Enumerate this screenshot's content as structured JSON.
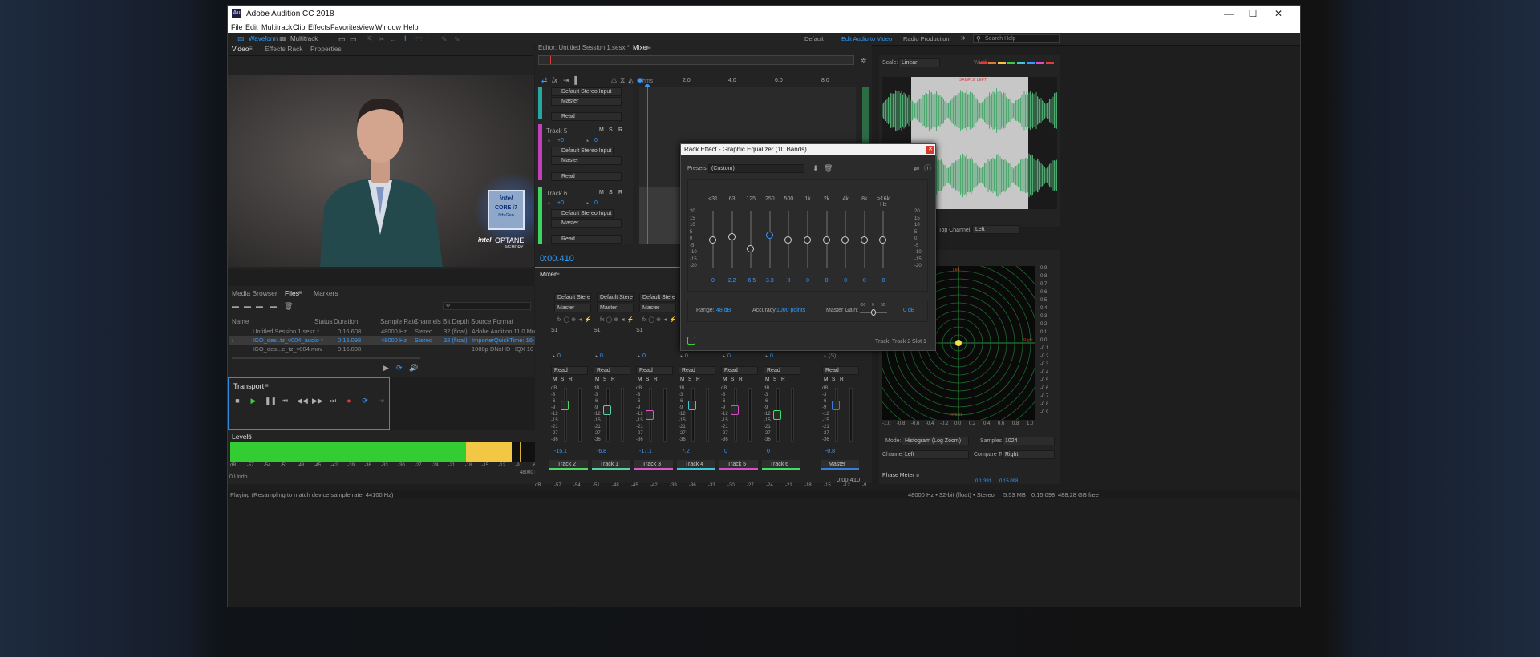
{
  "app": {
    "title": "Adobe Audition CC 2018",
    "logo_text": "Au",
    "window_controls": {
      "minimize": "—",
      "maximize": "☐",
      "close": "✕"
    }
  },
  "menu": [
    "File",
    "Edit",
    "Multitrack",
    "Clip",
    "Effects",
    "Favorites",
    "View",
    "Window",
    "Help"
  ],
  "toolbar": {
    "waveform": "Waveform",
    "multitrack": "Multitrack",
    "workspaces": [
      "Default",
      "Edit Audio to Video",
      "Radio Production"
    ],
    "overflow": "»",
    "search_placeholder": "Search Help"
  },
  "left_tabs": {
    "video": "Video",
    "effects_rack": "Effects Rack",
    "properties": "Properties"
  },
  "video": {
    "badge_brand": "intel",
    "badge_line1": "CORE i7",
    "badge_line2": "8th Gen",
    "optane_brand": "intel",
    "optane": "OPTANE",
    "optane_sub": "MEMORY"
  },
  "files_tabs": {
    "media_browser": "Media Browser",
    "files": "Files",
    "markers": "Markers"
  },
  "files_columns": [
    "Name",
    "Status",
    "Duration",
    "Sample Rate",
    "Channels",
    "Bit Depth",
    "Source Format"
  ],
  "files_rows": [
    {
      "name": "Untitled Session 1.sesx *",
      "status": "",
      "duration": "0:16.608",
      "rate": "48000 Hz",
      "channels": "Stereo",
      "bits": "32 (float)",
      "format": "Adobe Audition 11.0 Multitrack Session"
    },
    {
      "name": "IGO_des..tz_v004_audio *",
      "status": "",
      "duration": "0:15.098",
      "rate": "48000 Hz",
      "channels": "Stereo",
      "bits": "32 (float)",
      "format": "ImporterQuickTime: 16-bit"
    },
    {
      "name": "IGO_des...e_tz_v004.mov",
      "status": "",
      "duration": "0:15.098",
      "rate": "",
      "channels": "",
      "bits": "",
      "format": "1080p DNxHD HQX 10-bit 1920w 1080h (..."
    }
  ],
  "transport": {
    "title": "Transport"
  },
  "levels": {
    "title": "Levels",
    "scale": [
      "dB",
      "-57",
      "-54",
      "-51",
      "-48",
      "-45",
      "-42",
      "-39",
      "-36",
      "-33",
      "-30",
      "-27",
      "-24",
      "-21",
      "-18",
      "-15",
      "-12",
      "-9",
      "-6",
      "-3",
      "0"
    ],
    "left_level_fraction": 0.825,
    "yellow_start_fraction": 0.69,
    "undo": "0 Undo",
    "format": "48000 Hz • 32-bit (float) •"
  },
  "editor": {
    "tab_editor": "Editor: Untitled Session 1.sesx *",
    "tab_mixer": "Mixer",
    "ruler_label": "hms",
    "ruler": [
      "2.0",
      "4.0",
      "6.0",
      "8.0"
    ],
    "time": "0:00.410",
    "tracks": [
      {
        "name": "Default Stereo Input",
        "out": "Master",
        "mode": "Read"
      },
      {
        "name": "Track 5",
        "vol": "+0",
        "pan": "0",
        "in": "Default Stereo Input",
        "out": "Master",
        "mode": "Read"
      },
      {
        "name": "Track 6",
        "vol": "+0",
        "pan": "0",
        "in": "Default Stereo Input",
        "out": "Master",
        "mode": "Read"
      }
    ]
  },
  "mixer": {
    "title": "Mixer",
    "strips": [
      {
        "name": "Track 2",
        "in": "Default Stere",
        "out": "Master",
        "val": "-15.1",
        "mode": "Read",
        "color": "#4cd964",
        "knob": "0"
      },
      {
        "name": "Track 1",
        "in": "Default Stere",
        "out": "Master",
        "val": "-6.8",
        "mode": "Read",
        "color": "#5ad1a0",
        "knob": "0"
      },
      {
        "name": "Track 3",
        "in": "Default Stere",
        "out": "Master",
        "val": "-17.1",
        "mode": "Read",
        "color": "#d75acb",
        "knob": "0"
      },
      {
        "name": "Track 4",
        "in": "",
        "out": "",
        "val": "7.2",
        "mode": "Read",
        "color": "#3ec7d6",
        "knob": "0"
      },
      {
        "name": "Track 5",
        "in": "",
        "out": "",
        "val": "0",
        "mode": "Read",
        "color": "#d64fc9",
        "knob": "0"
      },
      {
        "name": "Track 6",
        "in": "",
        "out": "",
        "val": "0",
        "mode": "Read",
        "color": "#3fe06a",
        "knob": "0"
      },
      {
        "name": "Master",
        "in": "",
        "out": "",
        "val": "-0.8",
        "mode": "Read",
        "color": "#3b7ddd",
        "knob": "(S)"
      }
    ],
    "slot": "S1",
    "msr": [
      "M",
      "S",
      "R"
    ],
    "fader_scale": [
      "dB",
      "-3",
      "-6",
      "-9",
      "-12",
      "-15",
      "-21",
      "-27",
      "-36"
    ],
    "time": "0:00.410",
    "bottom_scale": [
      "dB",
      "-57",
      "-54",
      "-51",
      "-48",
      "-45",
      "-42",
      "-39",
      "-36",
      "-33",
      "-30",
      "-27",
      "-24",
      "-21",
      "-18",
      "-15",
      "-12",
      "-9"
    ]
  },
  "eq": {
    "title": "Rack Effect - Graphic Equalizer (10 Bands)",
    "presets_label": "Presets:",
    "preset": "(Custom)",
    "bands": [
      "<31",
      "63",
      "125",
      "250",
      "500",
      "1k",
      "2k",
      "4k",
      "8k",
      ">16k Hz"
    ],
    "values": [
      "0",
      "2.2",
      "-6.5",
      "3.3",
      "0",
      "0",
      "0",
      "0",
      "0",
      "0"
    ],
    "gain_values": [
      0,
      2.2,
      -6.5,
      3.3,
      0,
      0,
      0,
      0,
      0,
      0
    ],
    "scale_left": [
      "20",
      "15",
      "10",
      "5",
      "0",
      "-5",
      "-10",
      "-15",
      "-20"
    ],
    "scale_right": [
      "20",
      "15",
      "10",
      "5",
      "0",
      "-5",
      "-10",
      "-15",
      "-20"
    ],
    "range_label": "Range:",
    "range": "48 dB",
    "accuracy_label": "Accuracy:",
    "accuracy": "1000 points",
    "master_gain_label": "Master Gain:",
    "master_gain_scale": [
      "-50",
      "0",
      "50"
    ],
    "master_gain": "0 dB",
    "track_info": "Track: Track 2",
    "slot_info": "Slot 1"
  },
  "right": {
    "scale_label": "Scale:",
    "scale": "Linear",
    "width_label": "Width",
    "top_channel_label": "Top Channel:",
    "top_channel": "Left",
    "mode_label": "Mode:",
    "mode": "Histogram (Log Zoom)",
    "samples_label": "Samples:",
    "samples": "1024",
    "channel_label": "Channel:",
    "channel": "Left",
    "compare_label": "Compare To:",
    "compare": "Right",
    "phase_title": "Phase Meter",
    "waveform_label": "SAMPLE LEFT",
    "phase_top": "Left",
    "phase_right": "Right",
    "phase_bottom": "Inverse",
    "phase_x": [
      "-1.0",
      "-0.8",
      "-0.6",
      "-0.4",
      "-0.2",
      "0.0",
      "0.2",
      "0.4",
      "0.6",
      "0.8",
      "1.0"
    ],
    "phase_y": [
      "0.9",
      "0.8",
      "0.7",
      "0.6",
      "0.5",
      "0.4",
      "0.3",
      "0.2",
      "0.1",
      "0.0",
      "-0.1",
      "-0.2",
      "-0.3",
      "-0.4",
      "-0.5",
      "-0.6",
      "-0.7",
      "-0.8",
      "-0.9"
    ],
    "readout": [
      "-0.0001",
      "0.1.391",
      "0:15.098"
    ]
  },
  "status": {
    "left": "Playing (Resampling to match device sample rate: 44100 Hz)",
    "right": "48000 Hz • 32-bit (float) • Stereo",
    "size": "5.53 MB",
    "duration": "0:15.098",
    "free": "488.28 GB free"
  },
  "colors": {
    "accent": "#2f9dff",
    "green": "#3ccc3c",
    "yellow": "#f2c744",
    "wave": "#4fa870",
    "record": "#e03c3c"
  }
}
